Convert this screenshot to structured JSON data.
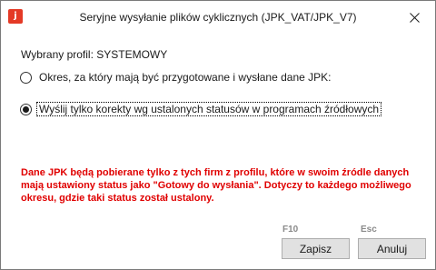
{
  "window": {
    "title": "Seryjne wysyłanie plików cyklicznych (JPK_VAT/JPK_V7)",
    "app_icon_glyph": "j",
    "accent_color": "#e43a26"
  },
  "profile": {
    "label": "Wybrany profil: SYSTEMOWY"
  },
  "options": [
    {
      "label": "Okres, za który mają być przygotowane i wysłane dane JPK:",
      "selected": false
    },
    {
      "label": "Wyślij tylko korekty wg ustalonych statusów w programach źródłowych",
      "selected": true
    }
  ],
  "warning": {
    "color": "#e00000",
    "lines": [
      "Dane JPK będą pobierane tylko z tych firm z profilu, które w swoim źródle danych",
      "mają ustawiony status jako \"Gotowy do wysłania\". Dotyczy to każdego możliwego",
      "okresu, gdzie taki status został ustalony."
    ]
  },
  "buttons": {
    "save": {
      "label": "Zapisz",
      "hotkey": "F10"
    },
    "cancel": {
      "label": "Anuluj",
      "hotkey": "Esc"
    }
  }
}
